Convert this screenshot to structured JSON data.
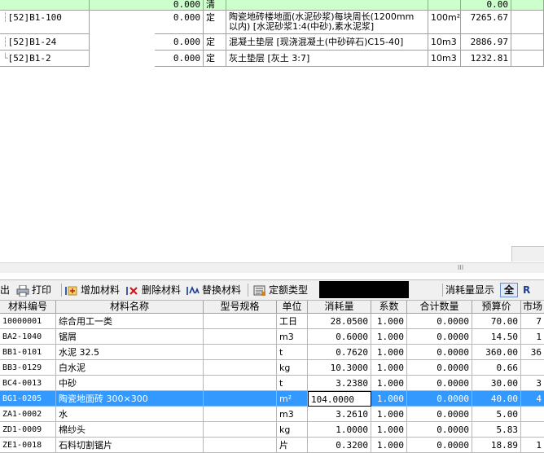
{
  "top_table": {
    "rows": [
      {
        "code": "",
        "qty": "0.000",
        "type": "清",
        "desc": "",
        "unit": "",
        "price": "0.00",
        "green": true
      },
      {
        "code": "[52]B1-100",
        "qty": "0.000",
        "type": "定",
        "desc": "陶瓷地砖楼地面(水泥砂浆)每块周长(1200mm",
        "desc2": "以内) [水泥砂浆1:4(中砂),素水泥浆]",
        "unit": "100m²",
        "price": "7265.67"
      },
      {
        "code": "[52]B1-24",
        "qty": "0.000",
        "type": "定",
        "desc": "混凝土垫层 [现浇混凝土(中砂碎石)C15-40]",
        "unit": "10m3",
        "price": "2886.97"
      },
      {
        "code": "[52]B1-2",
        "qty": "0.000",
        "type": "定",
        "desc": "灰土垫层 [灰土 3:7]",
        "unit": "10m3",
        "price": "1232.81"
      }
    ]
  },
  "scroll": {
    "grip": "III"
  },
  "toolbar": {
    "out_label": "出",
    "print_label": "打印",
    "add_label": "增加材料",
    "delete_label": "删除材料",
    "replace_label": "替换材料",
    "quota_label": "定额类型",
    "consume_label": "消耗量显示",
    "all_label": "全",
    "r_label": "R"
  },
  "materials": {
    "headers": [
      "材料编号",
      "材料名称",
      "型号规格",
      "单位",
      "消耗量",
      "系数",
      "合计数量",
      "预算价",
      "市场"
    ],
    "rows": [
      {
        "code": "10000001",
        "name": "综合用工一类",
        "spec": "",
        "unit": "工日",
        "qty": "28.0500",
        "coef": "1.000",
        "total": "0.0000",
        "price": "70.00",
        "market": "7"
      },
      {
        "code": "BA2-1040",
        "name": "锯屑",
        "spec": "",
        "unit": "m3",
        "qty": "0.6000",
        "coef": "1.000",
        "total": "0.0000",
        "price": "14.50",
        "market": "1"
      },
      {
        "code": "BB1-0101",
        "name": "水泥 32.5",
        "spec": "",
        "unit": "t",
        "qty": "0.7620",
        "coef": "1.000",
        "total": "0.0000",
        "price": "360.00",
        "market": "36"
      },
      {
        "code": "BB3-0129",
        "name": "白水泥",
        "spec": "",
        "unit": "kg",
        "qty": "10.3000",
        "coef": "1.000",
        "total": "0.0000",
        "price": "0.66",
        "market": ""
      },
      {
        "code": "BC4-0013",
        "name": "中砂",
        "spec": "",
        "unit": "t",
        "qty": "3.2380",
        "coef": "1.000",
        "total": "0.0000",
        "price": "30.00",
        "market": "3"
      },
      {
        "code": "BG1-0205",
        "name": "陶瓷地面砖 300×300",
        "spec": "",
        "unit": "m²",
        "qty": "104.0000",
        "coef": "1.000",
        "total": "0.0000",
        "price": "40.00",
        "market": "4",
        "selected": true
      },
      {
        "code": "ZA1-0002",
        "name": "水",
        "spec": "",
        "unit": "m3",
        "qty": "3.2610",
        "coef": "1.000",
        "total": "0.0000",
        "price": "5.00",
        "market": ""
      },
      {
        "code": "ZD1-0009",
        "name": "棉纱头",
        "spec": "",
        "unit": "kg",
        "qty": "1.0000",
        "coef": "1.000",
        "total": "0.0000",
        "price": "5.83",
        "market": ""
      },
      {
        "code": "ZE1-0018",
        "name": "石料切割锯片",
        "spec": "",
        "unit": "片",
        "qty": "0.3200",
        "coef": "1.000",
        "total": "0.0000",
        "price": "18.89",
        "market": "1"
      }
    ]
  },
  "colors": {
    "green_row": "#ccffcc",
    "selected_row": "#3399ff",
    "toolbar_bg": "#f0f0f0"
  }
}
